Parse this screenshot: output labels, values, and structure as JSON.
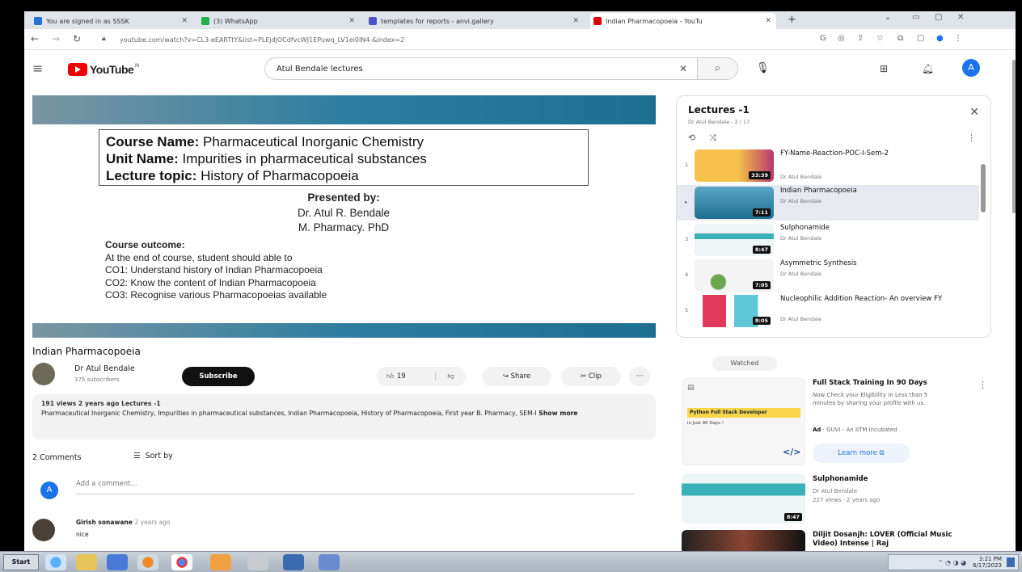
{
  "browser": {
    "tabs": [
      {
        "title": "You are signed in as SSSK",
        "fav_color": "#2a6fd6"
      },
      {
        "title": "(3) WhatsApp",
        "fav_color": "#22b04b"
      },
      {
        "title": "templates for reports - anvi.gallery",
        "fav_color": "#4a55c8"
      },
      {
        "title": "Indian Pharmacopoeia - YouTu",
        "fav_color": "#e00000"
      }
    ],
    "url": "youtube.com/watch?v=CL3-eEARTtY&list=PLEjdjOCdfvcWJ1EPuwq_LV1ei0IN4-&index=2"
  },
  "youtube": {
    "logo_text": "YouTube",
    "logo_sup": "IN",
    "search_value": "Atul Bendale lectures",
    "avatar_letter": "A"
  },
  "slide": {
    "course_label": "Course Name:",
    "course_value": "Pharmaceutical Inorganic Chemistry",
    "unit_label": "Unit Name:",
    "unit_value": "Impurities in pharmaceutical substances",
    "topic_label": "Lecture topic:",
    "topic_value": "History of Pharmacopoeia",
    "presented_by": "Presented by:",
    "presenter_name": "Dr. Atul R. Bendale",
    "presenter_degree": "M. Pharmacy. PhD",
    "outcome_title": "Course outcome:",
    "outcome_lines": [
      "At the end of course, student should able to",
      "CO1: Understand history of Indian Pharmacopoeia",
      "CO2: Know the content of Indian Pharmacopoeia",
      "CO3: Recognise various Pharmacopoeias available"
    ]
  },
  "video": {
    "title": "Indian Pharmacopoeia",
    "channel": "Dr Atul Bendale",
    "subscribers": "375 subscribers",
    "subscribe_label": "Subscribe",
    "likes": "19",
    "share_label": "Share",
    "clip_label": "Clip",
    "more_label": "···",
    "desc_meta": "191 views  2 years ago  Lectures -1",
    "desc_text": "Pharmaceutical Inorganic Chemistry, Impurities in pharmaceutical substances, Indian Pharmacopoeia, History of Pharmacopoeia, First year B. Pharmacy, SEM-I",
    "show_more": "Show more"
  },
  "comments": {
    "count_label": "2 Comments",
    "sort_label": "Sort by",
    "add_placeholder": "Add a comment...",
    "user_letter": "A",
    "items": [
      {
        "author": "Girish sonawane",
        "time": "2 years ago",
        "text": "nice"
      }
    ]
  },
  "playlist": {
    "title": "Lectures -1",
    "subtitle": "Dr Atul Bendale - 2 / 17",
    "items": [
      {
        "index": "1",
        "title": "FY-Name-Reaction-POC-I-Sem-2",
        "author": "Dr Atul Bendale",
        "duration": "33:39",
        "selected": false,
        "thumb": [
          "#f6c24a",
          "#b8386e"
        ]
      },
      {
        "index": "▸",
        "title": "Indian Pharmacopoeia",
        "author": "Dr Atul Bendale",
        "duration": "7:11",
        "selected": true,
        "thumb": [
          "#3c8fb0",
          "#1d6f91"
        ]
      },
      {
        "index": "3",
        "title": "Sulphonamide",
        "author": "Dr Atul Bendale",
        "duration": "8:47",
        "selected": false,
        "thumb": [
          "#e6f1f3",
          "#3ab0b8"
        ]
      },
      {
        "index": "4",
        "title": "Asymmetric Synthesis",
        "author": "Dr Atul Bendale",
        "duration": "7:05",
        "selected": false,
        "thumb": [
          "#f4f4f4",
          "#6aa84f"
        ]
      },
      {
        "index": "5",
        "title": "Nucleophilic Addition Reaction- An overview FY",
        "author": "Dr Atul Bendale",
        "duration": "8:05",
        "selected": false,
        "thumb": [
          "#e23a5a",
          "#5ec8d8"
        ]
      }
    ]
  },
  "sidebar": {
    "chip": "Watched",
    "ad": {
      "title": "Full Stack Training In 90 Days",
      "desc": "Now Check your Eligibility In Less than 5 minutes by sharing your profile with us.",
      "ad_badge": "Ad",
      "advertiser": "· GUVI - An IITM Incubated",
      "cta": "Learn more",
      "thumb_heading": "Python Full Stack Developer",
      "thumb_sub": "in Just 90 Days !"
    },
    "recs": [
      {
        "title": "Sulphonamide",
        "author": "Dr Atul Bendale",
        "meta": "227 views · 2 years ago",
        "duration": "8:47"
      },
      {
        "title": "Diljit Dosanjh: LOVER (Official Music Video) Intense | Raj",
        "author": "",
        "meta": "",
        "duration": ""
      }
    ]
  },
  "taskbar": {
    "start_label": "Start",
    "time": "3:21 PM",
    "date": "6/17/2023"
  }
}
